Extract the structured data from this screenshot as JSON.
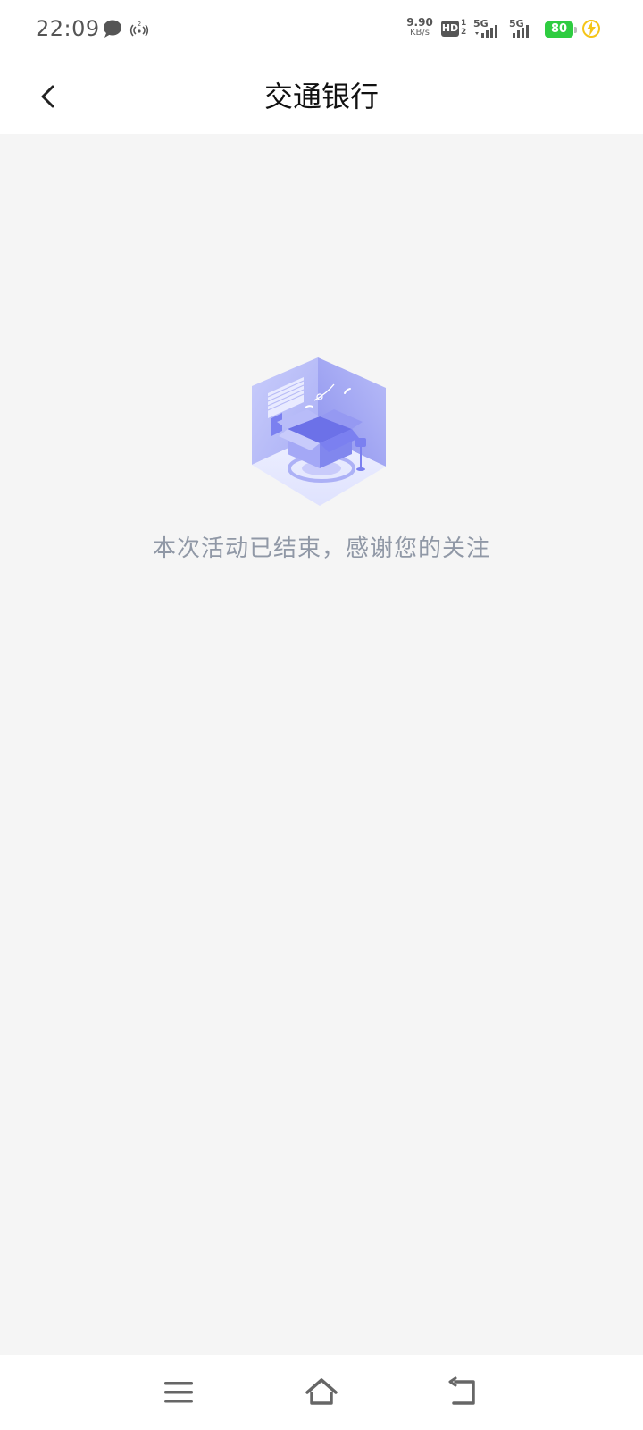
{
  "status_bar": {
    "time": "22:09",
    "net_speed_value": "9.90",
    "net_speed_unit": "KB/s",
    "hd_label": "HD",
    "signal1_label": "5G",
    "signal2_label": "5G",
    "battery_level": "80",
    "battery_color": "#2ecc40",
    "icons": [
      "message-icon",
      "hotspot-icon",
      "hd-icon",
      "signal-icon",
      "signal-icon",
      "battery-icon",
      "charging-icon"
    ]
  },
  "header": {
    "title": "交通银行",
    "back_icon": "chevron-left-icon"
  },
  "empty_state": {
    "illustration": "empty-box-room-illustration",
    "message": "本次活动已结束，感谢您的关注",
    "accent_color": "#7b80f0"
  },
  "nav_bar": {
    "buttons": [
      "menu-icon",
      "home-icon",
      "back-icon"
    ]
  }
}
